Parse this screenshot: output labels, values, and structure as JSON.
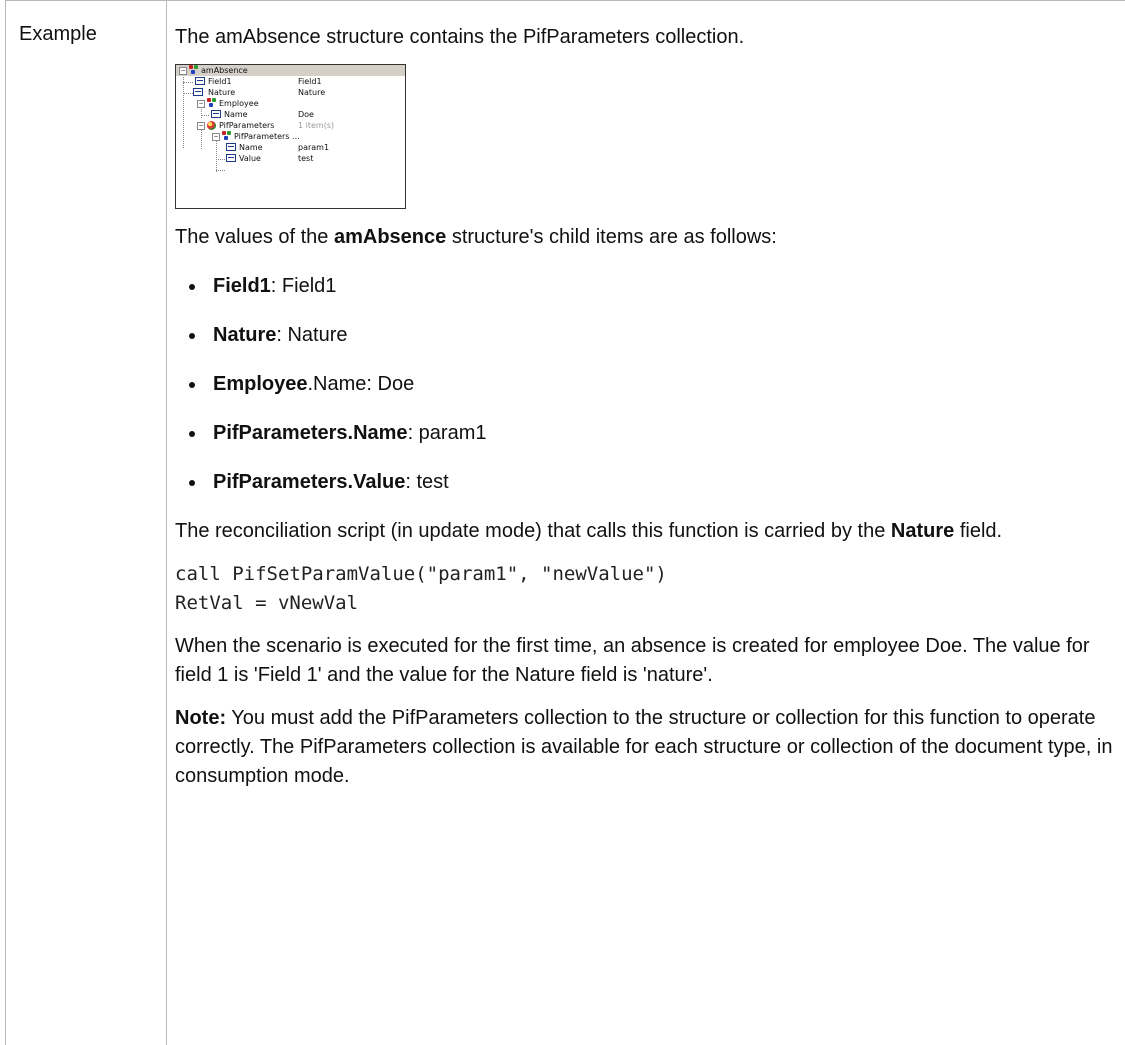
{
  "label": "Example",
  "intro": "The amAbsence structure contains the PifParameters collection.",
  "tree": [
    {
      "name": "amAbsence",
      "value": ""
    },
    {
      "name": "Field1",
      "value": "Field1"
    },
    {
      "name": "Nature",
      "value": "Nature"
    },
    {
      "name": "Employee",
      "value": ""
    },
    {
      "name": "Name",
      "value": "Doe"
    },
    {
      "name": "PifParameters",
      "value": "1 item(s)"
    },
    {
      "name": "PifParameters ...",
      "value": ""
    },
    {
      "name": "Name",
      "value": "param1"
    },
    {
      "name": "Value",
      "value": "test"
    }
  ],
  "values_intro": {
    "pre": "The values of the ",
    "bold": "amAbsence",
    "post": " structure's child items are as follows:"
  },
  "items": [
    {
      "bold": "Field1",
      "plain": "",
      "rest": ": Field1"
    },
    {
      "bold": "Nature",
      "plain": "",
      "rest": ": Nature"
    },
    {
      "bold": "Employee",
      "plain": ".Name",
      "rest": ": Doe"
    },
    {
      "bold": "PifParameters.Name",
      "plain": "",
      "rest": ": param1"
    },
    {
      "bold": "PifParameters.Value",
      "plain": "",
      "rest": ": test"
    }
  ],
  "script_para": {
    "pre": "The reconciliation script (in update mode) that calls this function is carried by the ",
    "bold": "Nature",
    "post": " field."
  },
  "code": [
    "call PifSetParamValue(\"param1\", \"newValue\")",
    "RetVal = vNewVal"
  ],
  "executed_para": "When the scenario is executed for the first time, an absence is created for employee Doe. The value for field 1 is 'Field 1' and the value for the Nature field is 'nature'.",
  "note": {
    "label": "Note:",
    "text": " You must add the PifParameters collection to the structure or collection for this function to operate correctly. The PifParameters collection is available for each structure or collection of the document type, in consumption mode."
  }
}
